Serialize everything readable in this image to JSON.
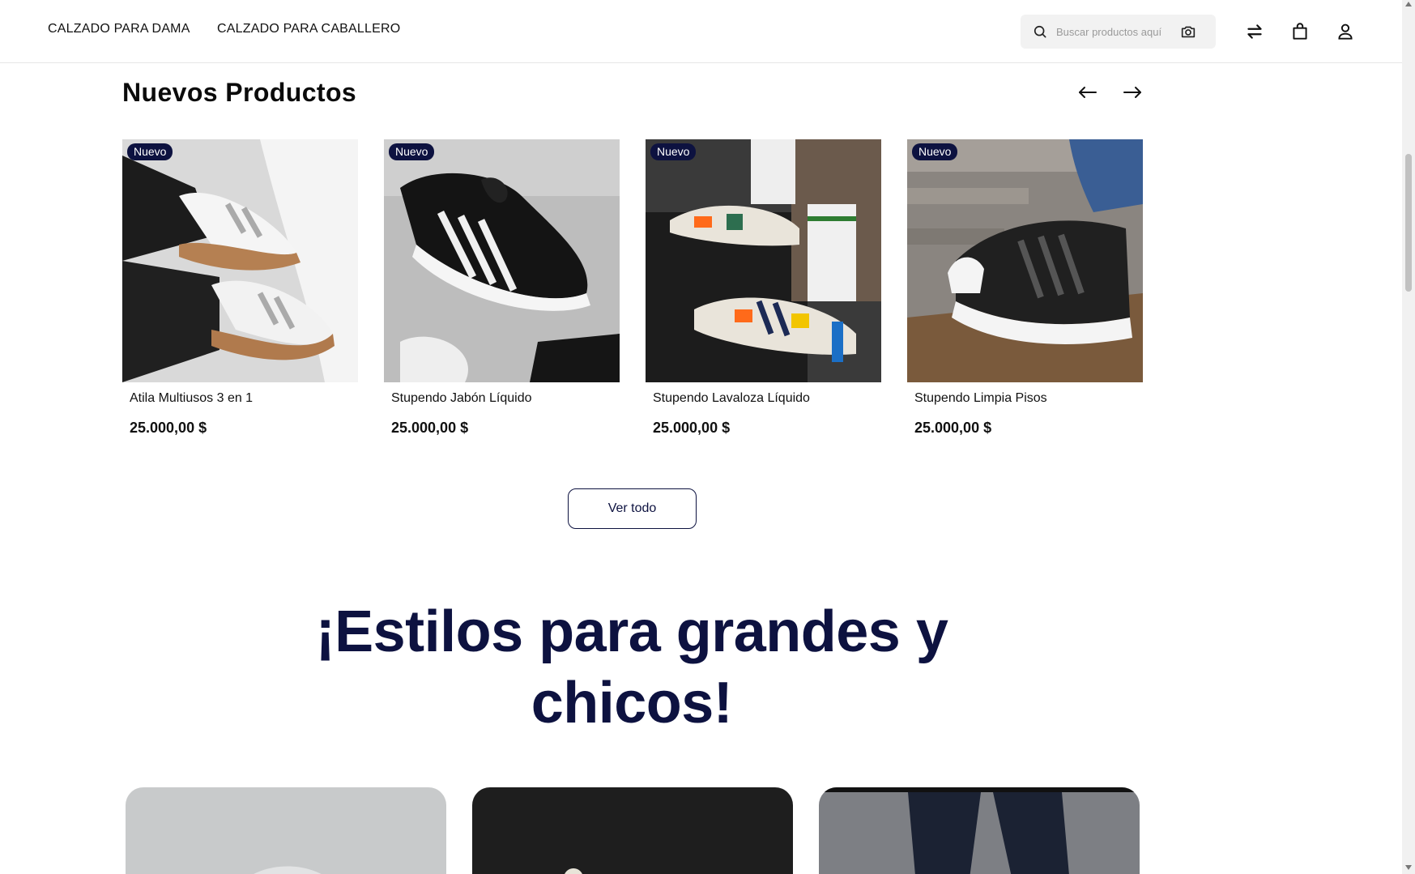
{
  "header": {
    "nav": [
      {
        "label": "CALZADO PARA DAMA"
      },
      {
        "label": "CALZADO PARA CABALLERO"
      }
    ],
    "search_placeholder": "Buscar productos aquí",
    "icons": [
      "search-icon",
      "camera-icon",
      "compare-icon",
      "shopping-bag-icon",
      "user-icon"
    ]
  },
  "new_products": {
    "title": "Nuevos Productos",
    "badge": "Nuevo",
    "products": [
      {
        "name": "Atila Multiusos 3 en 1",
        "price": "25.000,00 $"
      },
      {
        "name": "Stupendo Jabón Líquido",
        "price": "25.000,00 $"
      },
      {
        "name": "Stupendo Lavaloza Líquido",
        "price": "25.000,00 $"
      },
      {
        "name": "Stupendo Limpia Pisos",
        "price": "25.000,00 $"
      }
    ],
    "view_all_label": "Ver todo"
  },
  "styles_section": {
    "headline": "¡Estilos para grandes y chicos!"
  },
  "colors": {
    "brand_navy": "#0d1240",
    "badge_bg": "#0d1240",
    "search_bg": "#f2f2f2"
  }
}
